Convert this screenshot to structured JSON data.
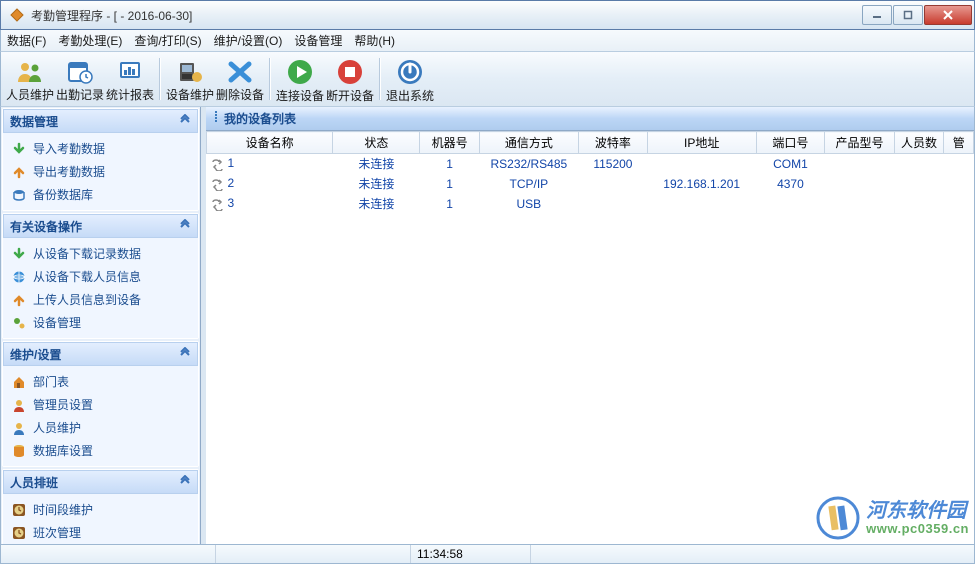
{
  "window": {
    "title": "考勤管理程序 - [ - 2016-06-30]"
  },
  "menubar": [
    {
      "label": "数据(F)"
    },
    {
      "label": "考勤处理(E)"
    },
    {
      "label": "查询/打印(S)"
    },
    {
      "label": "维护/设置(O)"
    },
    {
      "label": "设备管理"
    },
    {
      "label": "帮助(H)"
    }
  ],
  "toolbar": {
    "groups": [
      [
        {
          "k": "person",
          "label": "人员维护"
        },
        {
          "k": "attend",
          "label": "出勤记录"
        },
        {
          "k": "stats",
          "label": "统计报表"
        }
      ],
      [
        {
          "k": "device",
          "label": "设备维护"
        },
        {
          "k": "deldev",
          "label": "删除设备"
        }
      ],
      [
        {
          "k": "connect",
          "label": "连接设备"
        },
        {
          "k": "disconnect",
          "label": "断开设备"
        }
      ],
      [
        {
          "k": "exit",
          "label": "退出系统"
        }
      ]
    ]
  },
  "sidebar": {
    "panels": [
      {
        "title": "数据管理",
        "items": [
          {
            "ico": "down-green",
            "label": "导入考勤数据"
          },
          {
            "ico": "up-orange",
            "label": "导出考勤数据"
          },
          {
            "ico": "backup",
            "label": "备份数据库"
          }
        ]
      },
      {
        "title": "有关设备操作",
        "items": [
          {
            "ico": "down-green",
            "label": "从设备下载记录数据"
          },
          {
            "ico": "globe",
            "label": "从设备下载人员信息"
          },
          {
            "ico": "up-orange",
            "label": "上传人员信息到设备"
          },
          {
            "ico": "gears",
            "label": "设备管理"
          }
        ]
      },
      {
        "title": "维护/设置",
        "items": [
          {
            "ico": "house",
            "label": "部门表"
          },
          {
            "ico": "admin",
            "label": "管理员设置"
          },
          {
            "ico": "user",
            "label": "人员维护"
          },
          {
            "ico": "db",
            "label": "数据库设置"
          }
        ]
      },
      {
        "title": "人员排班",
        "items": [
          {
            "ico": "clock1",
            "label": "时间段维护"
          },
          {
            "ico": "clock2",
            "label": "班次管理"
          }
        ]
      }
    ]
  },
  "content": {
    "title": "我的设备列表",
    "columns": [
      "设备名称",
      "状态",
      "机器号",
      "通信方式",
      "波特率",
      "IP地址",
      "端口号",
      "产品型号",
      "人员数",
      "管"
    ],
    "rows": [
      {
        "name": "1",
        "status": "未连接",
        "machine": "1",
        "comm": "RS232/RS485",
        "baud": "115200",
        "ip": "",
        "port": "COM1"
      },
      {
        "name": "2",
        "status": "未连接",
        "machine": "1",
        "comm": "TCP/IP",
        "baud": "",
        "ip": "192.168.1.201",
        "port": "4370"
      },
      {
        "name": "3",
        "status": "未连接",
        "machine": "1",
        "comm": "USB",
        "baud": "",
        "ip": "",
        "port": ""
      }
    ]
  },
  "statusbar": {
    "time": "11:34:58"
  },
  "watermark": {
    "text": "河东软件园",
    "url": "www.pc0359.cn"
  }
}
